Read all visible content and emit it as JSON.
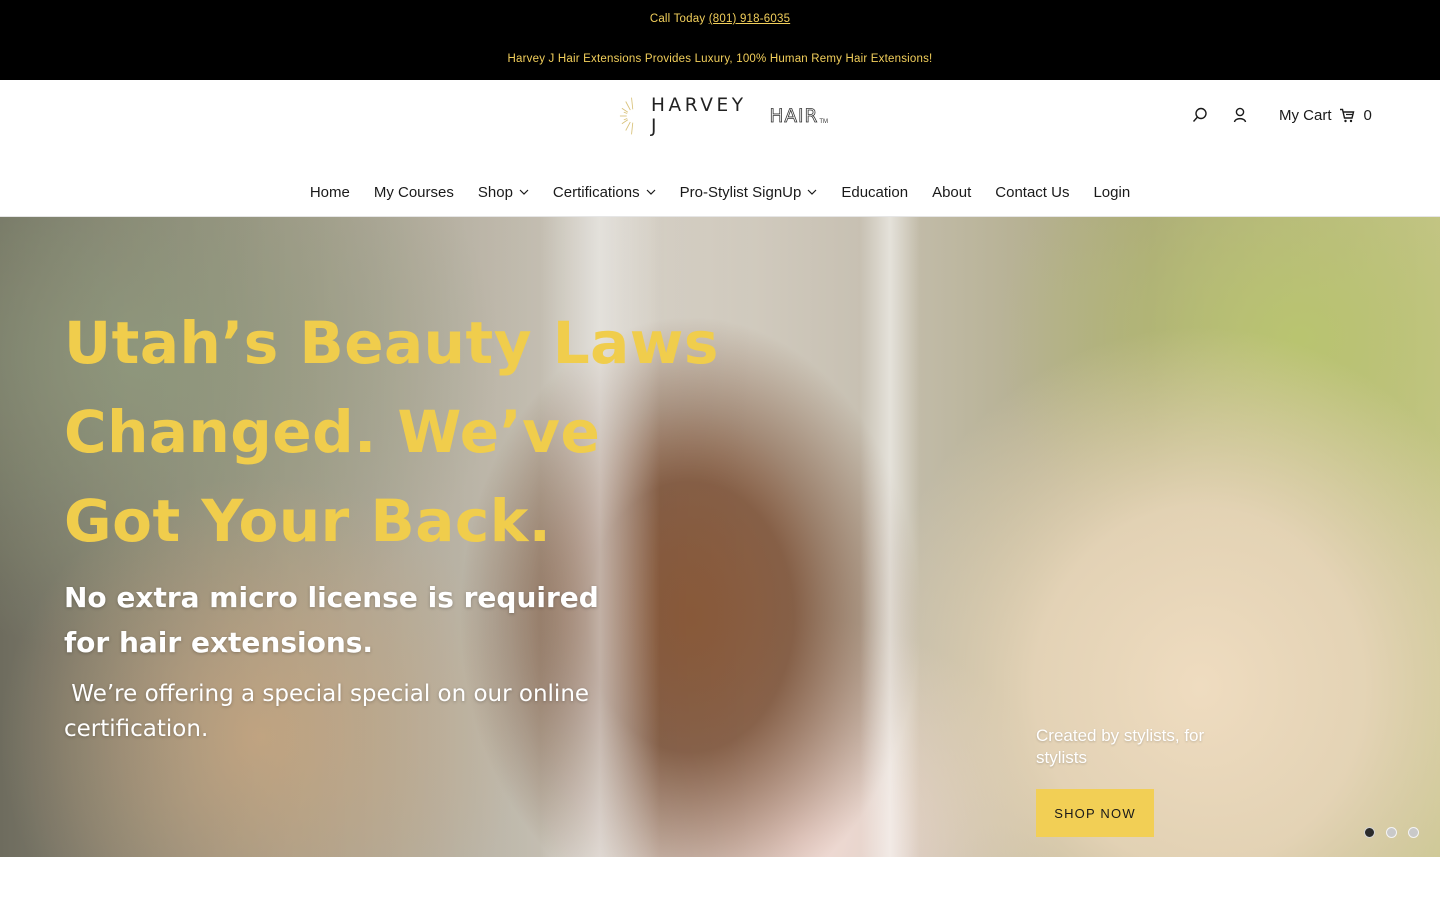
{
  "announcement": {
    "call_prefix": "Call Today",
    "phone": "(801) 918-6035",
    "message": "Harvey J Hair Extensions Provides Luxury, 100% Human Remy Hair Extensions!"
  },
  "logo": {
    "main_text": "HARVEY J",
    "hair_text": "HAIR",
    "tm": "TM"
  },
  "header": {
    "cart_label": "My Cart",
    "cart_count": "0",
    "icons": [
      "search-icon",
      "account-icon",
      "cart-icon"
    ]
  },
  "nav": {
    "items": [
      {
        "label": "Home",
        "dropdown": false
      },
      {
        "label": "My Courses",
        "dropdown": false
      },
      {
        "label": "Shop",
        "dropdown": true
      },
      {
        "label": "Certifications",
        "dropdown": true
      },
      {
        "label": "Pro-Stylist SignUp",
        "dropdown": true
      },
      {
        "label": "Education",
        "dropdown": false
      },
      {
        "label": "About",
        "dropdown": false
      },
      {
        "label": "Contact Us",
        "dropdown": false
      },
      {
        "label": "Login",
        "dropdown": false
      }
    ]
  },
  "hero": {
    "heading_lines": [
      "Utah’s Beauty Laws",
      "Changed. We’ve",
      "Got Your Back."
    ],
    "sub_lines": [
      "No extra micro license is required",
      "for hair extensions."
    ],
    "body_lines": [
      " We’re offering a special special on our online",
      "certification."
    ],
    "tagline": "Created by stylists, for stylists",
    "button_label": "SHOP NOW",
    "slides": 3,
    "active_slide": 1
  },
  "colors": {
    "announcement_bg": "#000000",
    "announcement_text": "#f2cf5b",
    "hero_heading": "#f0cd4c",
    "button_bg": "#f2cf55"
  }
}
